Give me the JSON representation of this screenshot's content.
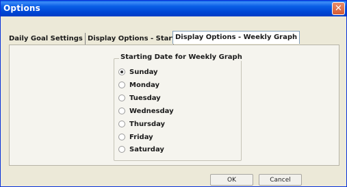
{
  "window": {
    "title": "Options"
  },
  "tabs": [
    {
      "label": "Daily Goal Settings"
    },
    {
      "label": "Display Options - Startup"
    },
    {
      "label": "Display Options - Weekly Graph",
      "active": true
    }
  ],
  "group": {
    "legend": "Starting Date for Weekly Graph"
  },
  "days": [
    {
      "label": "Sunday",
      "checked": true
    },
    {
      "label": "Monday",
      "checked": false
    },
    {
      "label": "Tuesday",
      "checked": false
    },
    {
      "label": "Wednesday",
      "checked": false
    },
    {
      "label": "Thursday",
      "checked": false
    },
    {
      "label": "Friday",
      "checked": false
    },
    {
      "label": "Saturday",
      "checked": false
    }
  ],
  "buttons": {
    "ok": "OK",
    "cancel": "Cancel"
  },
  "colors": {
    "titlebar": "#0a5fe6",
    "close": "#d55b33",
    "dialog_bg": "#ece9d8"
  },
  "icons": {
    "close": "close-icon"
  }
}
